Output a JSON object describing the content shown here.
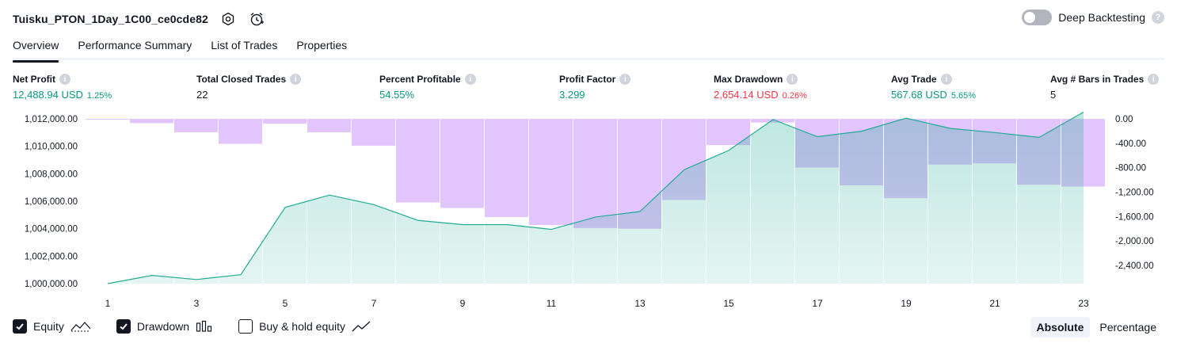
{
  "header": {
    "strategy_name": "Tuisku_PTON_1Day_1C00_ce0cde82",
    "deep_backtesting_label": "Deep Backtesting"
  },
  "tabs": [
    {
      "label": "Overview"
    },
    {
      "label": "Performance Summary"
    },
    {
      "label": "List of Trades"
    },
    {
      "label": "Properties"
    }
  ],
  "metrics": [
    {
      "label": "Net Profit",
      "value": "12,488.94 USD",
      "pct": "1.25%",
      "color": "#089981"
    },
    {
      "label": "Total Closed Trades",
      "value": "22",
      "pct": "",
      "color": "#131722"
    },
    {
      "label": "Percent Profitable",
      "value": "54.55%",
      "pct": "",
      "color": "#089981"
    },
    {
      "label": "Profit Factor",
      "value": "3.299",
      "pct": "",
      "color": "#089981"
    },
    {
      "label": "Max Drawdown",
      "value": "2,654.14 USD",
      "pct": "0.26%",
      "color": "#f23645"
    },
    {
      "label": "Avg Trade",
      "value": "567.68 USD",
      "pct": "5.65%",
      "color": "#089981"
    },
    {
      "label": "Avg # Bars in Trades",
      "value": "5",
      "pct": "",
      "color": "#131722"
    }
  ],
  "legend": {
    "equity_label": "Equity",
    "drawdown_label": "Drawdown",
    "buyhold_label": "Buy & hold equity",
    "equity_checked": true,
    "drawdown_checked": true,
    "buyhold_checked": false
  },
  "scale_switch": {
    "absolute_label": "Absolute",
    "percentage_label": "Percentage",
    "active": "Absolute"
  },
  "chart_data": {
    "type": "line",
    "x": [
      1,
      2,
      3,
      4,
      5,
      6,
      7,
      8,
      9,
      10,
      11,
      12,
      13,
      14,
      15,
      16,
      17,
      18,
      19,
      20,
      21,
      22,
      23
    ],
    "x_tick_labels": [
      "1",
      "3",
      "5",
      "7",
      "9",
      "11",
      "13",
      "15",
      "17",
      "19",
      "21",
      "23"
    ],
    "xlim": [
      1,
      23
    ],
    "series": [
      {
        "name": "Equity",
        "axis": "left",
        "color": "#22ab94",
        "values": [
          1000000,
          1000600,
          1000300,
          1000650,
          1005550,
          1006450,
          1005750,
          1004600,
          1004300,
          1004300,
          1003950,
          1004850,
          1005250,
          1008300,
          1009700,
          1011950,
          1010700,
          1011100,
          1012050,
          1011300,
          1011000,
          1010650,
          1012489
        ]
      },
      {
        "name": "Drawdown",
        "axis": "right",
        "color": "#d7aefb",
        "type": "bar",
        "values": [
          -10,
          -70,
          -220,
          -410,
          -80,
          -220,
          -440,
          -1370,
          -1460,
          -1610,
          -1740,
          -1790,
          -1800,
          -1330,
          -430,
          -60,
          -800,
          -1090,
          -1300,
          -750,
          -730,
          -1080,
          -1110
        ]
      }
    ],
    "left_axis": {
      "ylim": [
        1000000,
        1012000
      ],
      "ticks": [
        "1,000,000.00",
        "1,002,000.00",
        "1,004,000.00",
        "1,006,000.00",
        "1,008,000.00",
        "1,010,000.00",
        "1,012,000.00"
      ]
    },
    "right_axis": {
      "ylim": [
        -2700,
        0
      ],
      "ticks": [
        "0.00",
        "-400.00",
        "-800.00",
        "-1,200.00",
        "-1,600.00",
        "-2,000.00",
        "-2,400.00"
      ]
    },
    "grid": "vertical"
  }
}
